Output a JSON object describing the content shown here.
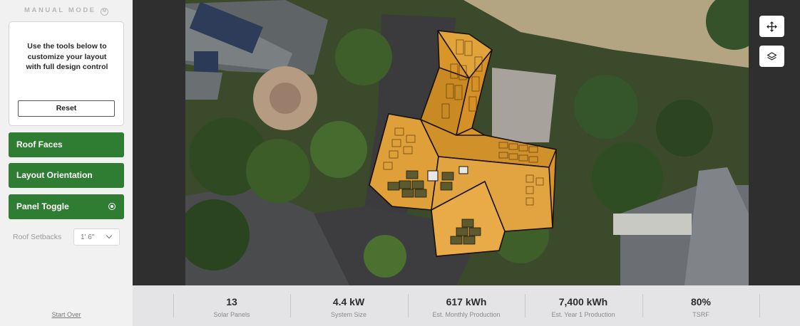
{
  "sidebar": {
    "mode_title": "MANUAL MODE",
    "mode_icon_letter": "M",
    "info_text": "Use the tools below to customize your layout with full design control",
    "reset_label": "Reset",
    "buttons": [
      {
        "label": "Roof Faces"
      },
      {
        "label": "Layout Orientation"
      },
      {
        "label": "Panel Toggle",
        "icon": "toggle-icon"
      }
    ],
    "setbacks_label": "Roof Setbacks",
    "setbacks_value": "1' 6\"",
    "start_over": "Start Over"
  },
  "map": {
    "controls": [
      {
        "icon": "move-icon"
      },
      {
        "icon": "layers-icon"
      }
    ]
  },
  "stats": [
    {
      "value": "13",
      "label": "Solar Panels"
    },
    {
      "value": "4.4 kW",
      "label": "System Size"
    },
    {
      "value": "617 kWh",
      "label": "Est. Monthly Production"
    },
    {
      "value": "7,400 kWh",
      "label": "Est. Year 1 Production"
    },
    {
      "value": "80%",
      "label": "TSRF"
    }
  ],
  "colors": {
    "accent_green": "#2e7d32",
    "roof_orange": "#d9952a",
    "panel_olive": "#5c5a2e"
  }
}
